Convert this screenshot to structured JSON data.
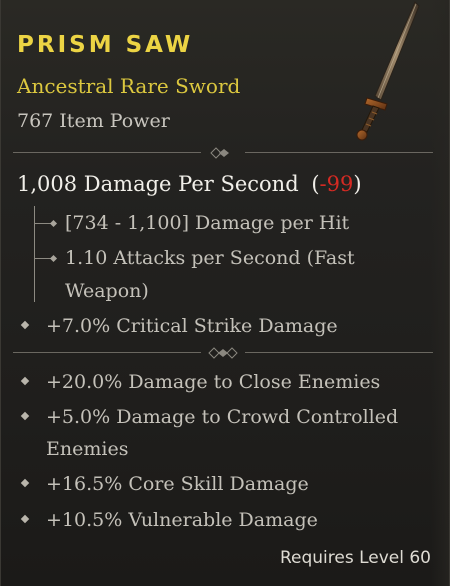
{
  "item": {
    "name": "PRISM SAW",
    "type": "Ancestral Rare Sword",
    "power": "767 Item Power",
    "image_icon": "sword-icon"
  },
  "dps": {
    "label": "1,008 Damage Per Second",
    "open_paren": "(",
    "delta": "-99",
    "close_paren": ")"
  },
  "weapon_stats": [
    {
      "line1": "[734 - 1,100] Damage per Hit",
      "line2": ""
    },
    {
      "line1": "1.10 Attacks per Second (Fast",
      "line2": "Weapon)"
    }
  ],
  "implicit_affixes": [
    "+7.0% Critical Strike Damage"
  ],
  "affixes": [
    {
      "line1": "+20.0% Damage to Close Enemies",
      "line2": ""
    },
    {
      "line1": "+5.0% Damage to Crowd Controlled",
      "line2": "Enemies"
    },
    {
      "line1": "+16.5% Core Skill Damage",
      "line2": ""
    },
    {
      "line1": "+10.5% Vulnerable Damage",
      "line2": ""
    }
  ],
  "requirement": "Requires Level 60",
  "colors": {
    "rare_name": "#ecd444",
    "rare_type": "#dcc83f",
    "negative": "#d52a23",
    "text": "#c4c1b9"
  }
}
